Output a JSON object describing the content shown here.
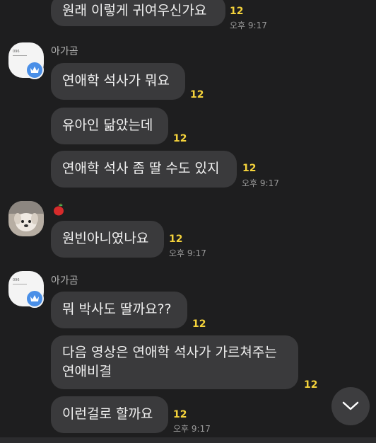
{
  "messages": [
    {
      "text": "원래 이렇게 귀여우신가요",
      "count": "12",
      "time": "오후 9:17"
    },
    {
      "text": "연애학 석사가 뭐요",
      "count": "12"
    },
    {
      "text": "유아인 닮았는데",
      "count": "12"
    },
    {
      "text": "연애학 석사 좀 딸 수도 있지",
      "count": "12",
      "time": "오후 9:17"
    },
    {
      "text": "원빈아니였나요",
      "count": "12",
      "time": "오후 9:17"
    },
    {
      "text": "뭐 박사도 딸까요??",
      "count": "12"
    },
    {
      "text": "다음 영상은 연애학 석사가 가르쳐주는 연애비결",
      "count": "12"
    },
    {
      "text": "이런걸로 할까요",
      "count": "12",
      "time": "오후 9:17"
    }
  ],
  "senders": {
    "sender_a": "아가곰"
  },
  "avatar_a_text": "096",
  "icons": {
    "crown": "crown-icon",
    "apple": "apple-icon",
    "scroll_down": "chevron-down-icon"
  },
  "colors": {
    "background": "#1e1e1f",
    "bubble": "#3a3a3c",
    "unread_count": "#f5d33b",
    "badge_blue": "#4a8fe7"
  }
}
